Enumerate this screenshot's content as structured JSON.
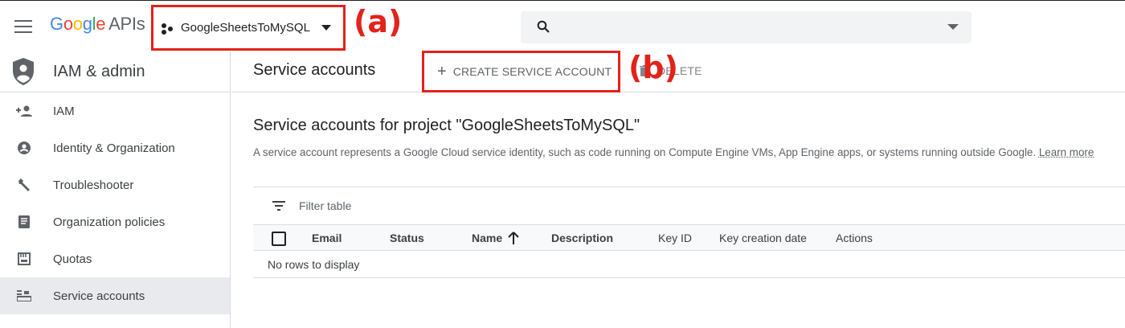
{
  "header": {
    "logo_parts": [
      "G",
      "o",
      "o",
      "g",
      "l",
      "e"
    ],
    "logo_suffix": "APIs",
    "project_name": "GoogleSheetsToMySQL",
    "annotation_a": "(a)",
    "search_placeholder": ""
  },
  "sidebar": {
    "title": "IAM & admin",
    "items": [
      {
        "label": "IAM",
        "icon": "person-add-icon"
      },
      {
        "label": "Identity & Organization",
        "icon": "account-circle-icon"
      },
      {
        "label": "Troubleshooter",
        "icon": "wrench-icon"
      },
      {
        "label": "Organization policies",
        "icon": "document-icon"
      },
      {
        "label": "Quotas",
        "icon": "quota-icon"
      },
      {
        "label": "Service accounts",
        "icon": "service-account-icon",
        "active": true
      }
    ]
  },
  "main": {
    "page_title": "Service accounts",
    "create_button": "CREATE SERVICE ACCOUNT",
    "delete_button": "DELETE",
    "annotation_b": "(b)",
    "section_title": "Service accounts for project \"GoogleSheetsToMySQL\"",
    "description": "A service account represents a Google Cloud service identity, such as code running on Compute Engine VMs, App Engine apps, or systems running outside Google.",
    "learn_more": "Learn more",
    "filter_placeholder": "Filter table",
    "columns": [
      "Email",
      "Status",
      "Name",
      "Description",
      "Key ID",
      "Key creation date",
      "Actions"
    ],
    "empty_message": "No rows to display"
  },
  "colors": {
    "annotation": "#e3221b",
    "active_bg": "#e8eaed"
  }
}
